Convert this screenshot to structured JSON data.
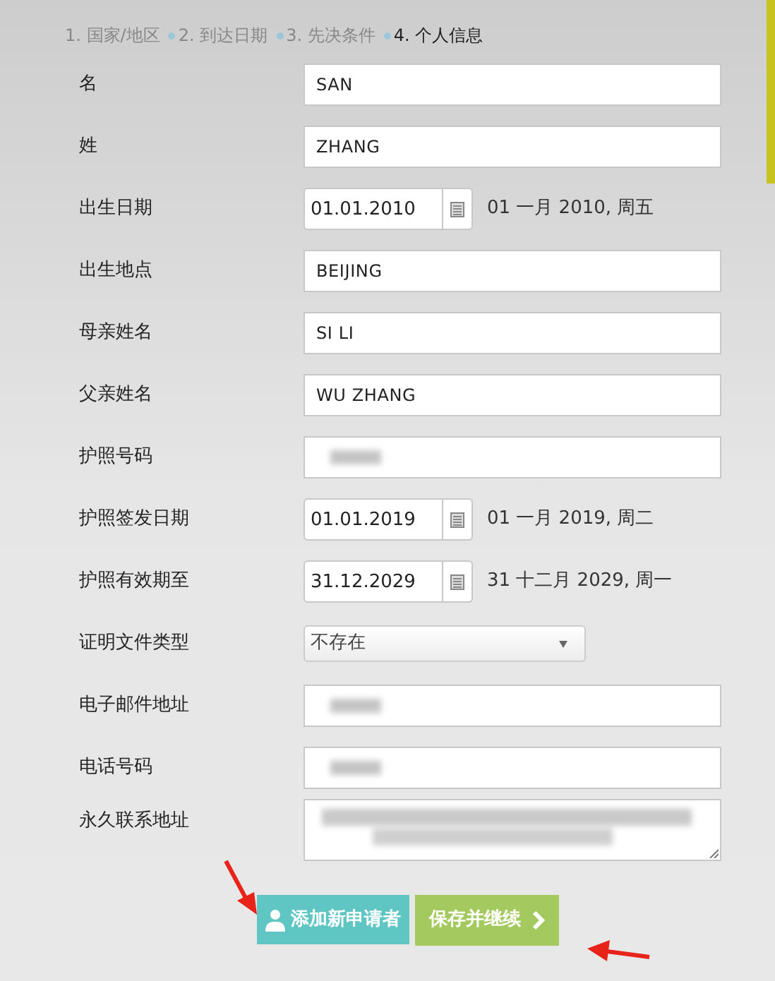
{
  "steps": [
    {
      "label": "1. 国家/地区",
      "selected": false
    },
    {
      "label": "2. 到达日期",
      "selected": false
    },
    {
      "label": "3. 先决条件",
      "selected": false
    },
    {
      "label": "4. 个人信息",
      "selected": true
    }
  ],
  "fields": [
    {
      "kind": "text",
      "label": "名",
      "value": "SAN",
      "redacted": false
    },
    {
      "kind": "text",
      "label": "姓",
      "value": "ZHANG",
      "redacted": false
    },
    {
      "kind": "date",
      "label": "出生日期",
      "value": "01.01.2010",
      "reading": "01 一月 2010, 周五"
    },
    {
      "kind": "text",
      "label": "出生地点",
      "value": "BEIJING",
      "redacted": false
    },
    {
      "kind": "text",
      "label": "母亲姓名",
      "value": "SI LI",
      "redacted": false
    },
    {
      "kind": "text",
      "label": "父亲姓名",
      "value": "WU ZHANG",
      "redacted": false
    },
    {
      "kind": "text",
      "label": "护照号码",
      "redacted": true
    },
    {
      "kind": "date",
      "label": "护照签发日期",
      "value": "01.01.2019",
      "reading": "01 一月 2019, 周二"
    },
    {
      "kind": "date",
      "label": "护照有效期至",
      "value": "31.12.2029",
      "reading": "31 十二月 2029, 周一"
    },
    {
      "kind": "select",
      "label": "证明文件类型",
      "value": "不存在"
    },
    {
      "kind": "text",
      "label": "电子邮件地址",
      "redacted": true
    },
    {
      "kind": "text",
      "label": "电话号码",
      "redacted": true
    },
    {
      "kind": "textarea",
      "label": "永久联系地址",
      "redacted": true
    }
  ],
  "buttons": [
    {
      "kind": "add",
      "label": "添加新申请者"
    },
    {
      "kind": "next",
      "label": "保存并继续"
    }
  ]
}
